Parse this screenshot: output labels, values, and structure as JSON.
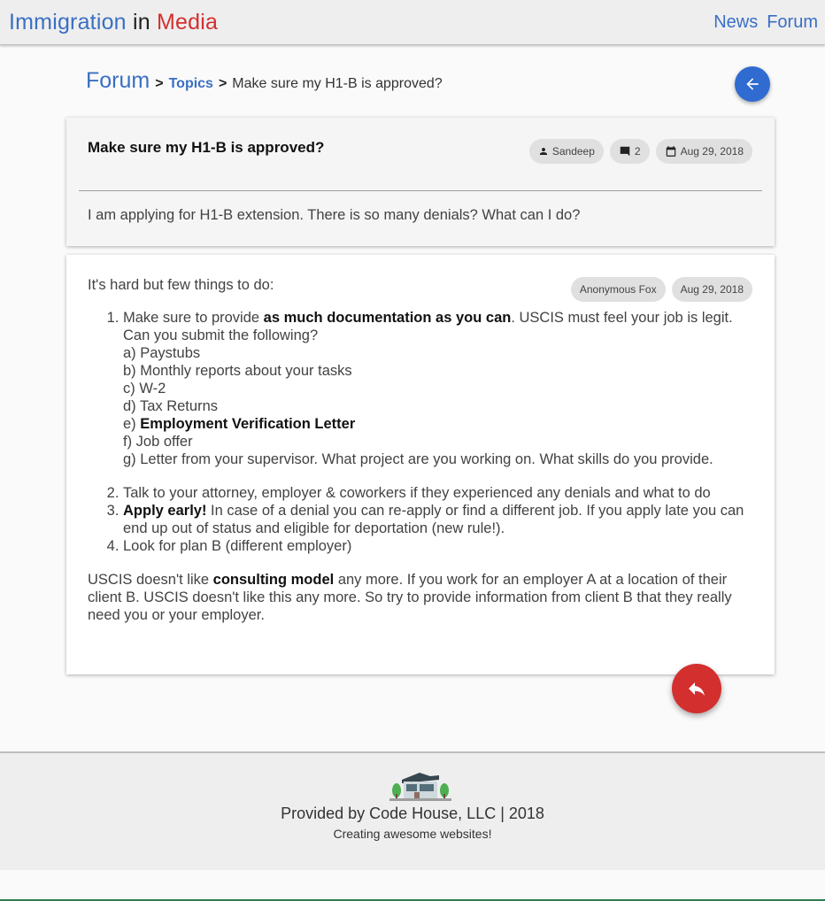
{
  "header": {
    "brand_part1": "Immigration",
    "brand_part2": "in",
    "brand_part3": "Media",
    "nav": [
      "News",
      "Forum"
    ]
  },
  "breadcrumb": {
    "forum": "Forum",
    "sep": ">",
    "topics": "Topics",
    "current": "Make sure my H1-B is approved?"
  },
  "question": {
    "title": "Make sure my H1-B is approved?",
    "author": "Sandeep",
    "comments": "2",
    "date": "Aug 29, 2018",
    "body": "I am applying for H1-B extension. There is so many denials? What can I do?"
  },
  "answer": {
    "author": "Anonymous Fox",
    "date": "Aug 29, 2018",
    "intro": "It's hard but few things to do:",
    "item1_pre": "Make sure to provide ",
    "item1_bold": "as much documentation as you can",
    "item1_post": ". USCIS must feel your job is legit. Can you submit the following?",
    "sub_a": "a) Paystubs",
    "sub_b": "b) Monthly reports about your tasks",
    "sub_c": "c) W-2",
    "sub_d": "d) Tax Returns",
    "sub_e_prefix": "e) ",
    "sub_e_bold": "Employment Verification Letter",
    "sub_f": "f) Job offer",
    "sub_g": "g) Letter from your supervisor. What project are you working on. What skills do you provide.",
    "item2": "Talk to your attorney, employer & coworkers if they experienced any denials and what to do",
    "item3_bold": "Apply early!",
    "item3_post": " In case of a denial you can re-apply or find a different job. If you apply late you can end up out of status and eligible for deportation (new rule!).",
    "item4": "Look for plan B (different employer)",
    "closing_pre": "USCIS doesn't like ",
    "closing_bold": "consulting model",
    "closing_post": " any more. If you work for an employer A at a location of their client B. USCIS doesn't like this any more. So try to provide information from client B that they really need you or your employer."
  },
  "footer": {
    "line1": "Provided by Code House, LLC | 2018",
    "line2": "Creating awesome websites!"
  },
  "colors": {
    "brand_blue": "#3a6fc4",
    "brand_red": "#d3302f",
    "back_fab": "#2f6bd0",
    "reply_fab": "#d32f2f"
  },
  "icons": {
    "back": "arrow-left-icon",
    "reply": "reply-icon",
    "author": "person-icon",
    "comments": "comment-icon",
    "date": "calendar-icon",
    "footer_logo": "house-logo"
  }
}
